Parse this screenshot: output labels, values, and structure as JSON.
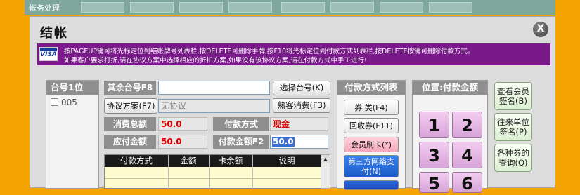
{
  "window": {
    "title": "帐务处理"
  },
  "dialog": {
    "title": "结帐",
    "close_label": "X",
    "notice": {
      "card_logo": "VISA",
      "line1": "按PAGEUP键可将光标定位到结账牌号列表栏,按DELETE可删除手牌,按F10将光标定位到付款方式列表栏,按DELETE按键可删除付款方式。",
      "line2": "如果客户要求打折,请在协议方案中选择相应的折扣方案,如果没有该协议方案,请在付款方式中手工进行!"
    }
  },
  "table_panel": {
    "header": "台号1位",
    "items": [
      {
        "label": "005"
      }
    ]
  },
  "form": {
    "merge_table_label": "其余台号F8",
    "merge_table_value": "",
    "select_table_button": "选择台号(K)",
    "agreement_button": "协议方案(F7)",
    "agreement_value": "无协议",
    "regular_guest_button": "熟客消费(F3)",
    "total_label": "消费总额",
    "total_value": "50.0",
    "payment_method_label": "付款方式",
    "payment_method_value": "现金",
    "due_label": "应付金额",
    "due_value": "50.0",
    "payment_amount_label": "付款金额F2",
    "payment_amount_value": "50.0"
  },
  "payment_grid": {
    "columns": [
      "付款方式",
      "金额",
      "卡余额",
      "说明"
    ]
  },
  "payment_methods": {
    "header": "付款方式列表",
    "items": [
      {
        "label": "券  类(F4)"
      },
      {
        "label": "回收券(F11)"
      },
      {
        "label": "会员刷卡(*)"
      },
      {
        "label": "第三方网络支付(N)"
      }
    ]
  },
  "amount_panel": {
    "header": "位置:付款金额",
    "keys": [
      "1",
      "2",
      "3",
      "4",
      "5",
      "6"
    ]
  },
  "side_buttons": [
    {
      "label": "查看会员签名(B)"
    },
    {
      "label": "往来单位签名(P)"
    },
    {
      "label": "各种券的查询(Q)"
    }
  ],
  "colors": {
    "notice_bg": "#7a1a8a",
    "page_bg": "#f4a300",
    "value_red": "#e00000",
    "key_purple": "#d7a3d8"
  }
}
